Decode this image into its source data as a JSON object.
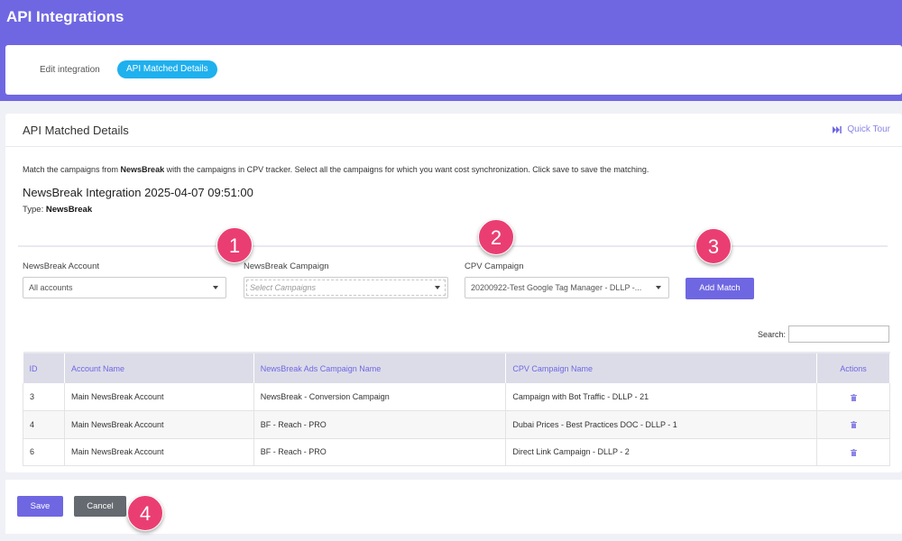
{
  "header": {
    "title": "API Integrations"
  },
  "tabs": [
    {
      "label": "Edit integration"
    },
    {
      "label": "API Matched Details"
    }
  ],
  "card": {
    "title": "API Matched Details",
    "quick_tour": "Quick Tour",
    "description_prefix": "Match the campaigns from ",
    "description_source": "NewsBreak",
    "description_suffix": " with the campaigns in CPV tracker. Select all the campaigns for which you want cost synchronization. Click save to save the matching.",
    "integration_title": "NewsBreak Integration 2025-04-07 09:51:00",
    "type_label": "Type: ",
    "type_value": "NewsBreak"
  },
  "filters": {
    "account_label": "NewsBreak Account",
    "account_value": "All accounts",
    "campaign_label": "NewsBreak Campaign",
    "campaign_placeholder": "Select Campaigns",
    "cpv_label": "CPV Campaign",
    "cpv_value": "20200922-Test Google Tag Manager  -  DLLP  -...",
    "add_match": "Add Match"
  },
  "search": {
    "label": "Search:",
    "value": ""
  },
  "table": {
    "headers": [
      "ID",
      "Account Name",
      "NewsBreak Ads Campaign Name",
      "CPV Campaign Name",
      "Actions"
    ],
    "rows": [
      {
        "id": "3",
        "account": "Main NewsBreak Account",
        "newsbreak_campaign": "NewsBreak - Conversion Campaign",
        "cpv_campaign": "Campaign with Bot Traffic - DLLP - 21"
      },
      {
        "id": "4",
        "account": "Main NewsBreak Account",
        "newsbreak_campaign": "BF - Reach - PRO",
        "cpv_campaign": "Dubai Prices - Best Practices DOC - DLLP - 1"
      },
      {
        "id": "6",
        "account": "Main NewsBreak Account",
        "newsbreak_campaign": "BF - Reach - PRO",
        "cpv_campaign": "Direct Link Campaign - DLLP - 2"
      }
    ]
  },
  "footer": {
    "save": "Save",
    "cancel": "Cancel"
  },
  "steps": [
    "1",
    "2",
    "3",
    "4"
  ],
  "icons": {
    "quick_tour": "fast-forward-icon",
    "delete": "trash-icon",
    "dropdown": "chevron-down-icon"
  },
  "colors": {
    "header": "#6f67e2",
    "accent": "#6f67e2",
    "active_tab": "#1fb0ee",
    "cancel": "#656970",
    "step_badge": "#ea3e72"
  }
}
